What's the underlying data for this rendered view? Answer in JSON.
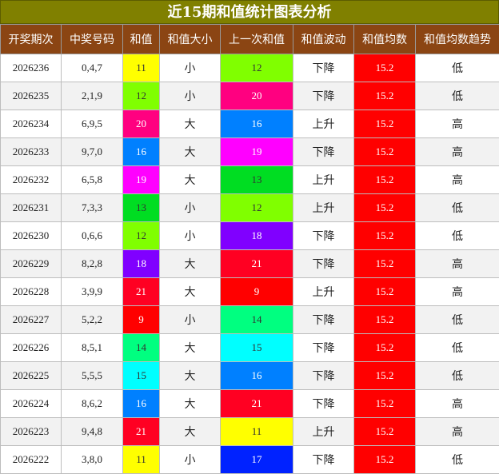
{
  "title": "近15期和值统计图表分析",
  "headers": [
    "开奖期次",
    "中奖号码",
    "和值",
    "和值大小",
    "上一次和值",
    "和值波动",
    "和值均数",
    "和值均数趋势"
  ],
  "colors": {
    "title_bg": "#808000",
    "header_bg": "#8b4513",
    "avg_bg": "#ff0000",
    "sum_colors": {
      "9": "#ff0000",
      "11": "#ffff00",
      "12": "#80ff00",
      "13": "#00dd22",
      "14": "#00ff80",
      "15": "#00ffff",
      "16": "#0080ff",
      "17": "#0022ff",
      "18": "#8000ff",
      "19": "#ff00ff",
      "20": "#ff0080",
      "21": "#ff0022"
    }
  },
  "rows": [
    {
      "period": "2026236",
      "numbers": "0,4,7",
      "sum": "11",
      "size": "小",
      "prev_sum": "12",
      "wave": "下降",
      "avg": "15.2",
      "trend": "低"
    },
    {
      "period": "2026235",
      "numbers": "2,1,9",
      "sum": "12",
      "size": "小",
      "prev_sum": "20",
      "wave": "下降",
      "avg": "15.2",
      "trend": "低"
    },
    {
      "period": "2026234",
      "numbers": "6,9,5",
      "sum": "20",
      "size": "大",
      "prev_sum": "16",
      "wave": "上升",
      "avg": "15.2",
      "trend": "高"
    },
    {
      "period": "2026233",
      "numbers": "9,7,0",
      "sum": "16",
      "size": "大",
      "prev_sum": "19",
      "wave": "下降",
      "avg": "15.2",
      "trend": "高"
    },
    {
      "period": "2026232",
      "numbers": "6,5,8",
      "sum": "19",
      "size": "大",
      "prev_sum": "13",
      "wave": "上升",
      "avg": "15.2",
      "trend": "高"
    },
    {
      "period": "2026231",
      "numbers": "7,3,3",
      "sum": "13",
      "size": "小",
      "prev_sum": "12",
      "wave": "上升",
      "avg": "15.2",
      "trend": "低"
    },
    {
      "period": "2026230",
      "numbers": "0,6,6",
      "sum": "12",
      "size": "小",
      "prev_sum": "18",
      "wave": "下降",
      "avg": "15.2",
      "trend": "低"
    },
    {
      "period": "2026229",
      "numbers": "8,2,8",
      "sum": "18",
      "size": "大",
      "prev_sum": "21",
      "wave": "下降",
      "avg": "15.2",
      "trend": "高"
    },
    {
      "period": "2026228",
      "numbers": "3,9,9",
      "sum": "21",
      "size": "大",
      "prev_sum": "9",
      "wave": "上升",
      "avg": "15.2",
      "trend": "高"
    },
    {
      "period": "2026227",
      "numbers": "5,2,2",
      "sum": "9",
      "size": "小",
      "prev_sum": "14",
      "wave": "下降",
      "avg": "15.2",
      "trend": "低"
    },
    {
      "period": "2026226",
      "numbers": "8,5,1",
      "sum": "14",
      "size": "大",
      "prev_sum": "15",
      "wave": "下降",
      "avg": "15.2",
      "trend": "低"
    },
    {
      "period": "2026225",
      "numbers": "5,5,5",
      "sum": "15",
      "size": "大",
      "prev_sum": "16",
      "wave": "下降",
      "avg": "15.2",
      "trend": "低"
    },
    {
      "period": "2026224",
      "numbers": "8,6,2",
      "sum": "16",
      "size": "大",
      "prev_sum": "21",
      "wave": "下降",
      "avg": "15.2",
      "trend": "高"
    },
    {
      "period": "2026223",
      "numbers": "9,4,8",
      "sum": "21",
      "size": "大",
      "prev_sum": "11",
      "wave": "上升",
      "avg": "15.2",
      "trend": "高"
    },
    {
      "period": "2026222",
      "numbers": "3,8,0",
      "sum": "11",
      "size": "小",
      "prev_sum": "17",
      "wave": "下降",
      "avg": "15.2",
      "trend": "低"
    }
  ]
}
